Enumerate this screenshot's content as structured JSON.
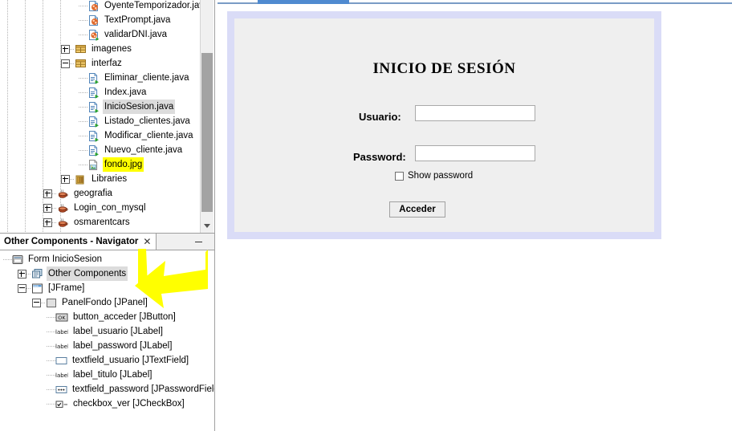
{
  "app": {
    "editor_tab_color": "#4f8ad0"
  },
  "projects_tree": {
    "nodes": [
      {
        "label": "OyenteTemporizador.java",
        "icon": "java-class-icon",
        "depth": 4,
        "expander": "none",
        "state": "normal"
      },
      {
        "label": "TextPrompt.java",
        "icon": "java-class-icon",
        "depth": 4,
        "expander": "none",
        "state": "normal"
      },
      {
        "label": "validarDNI.java",
        "icon": "java-class-main-icon",
        "depth": 4,
        "expander": "none",
        "state": "normal"
      },
      {
        "label": "imagenes",
        "icon": "package-icon",
        "depth": 3,
        "expander": "plus",
        "state": "normal"
      },
      {
        "label": "interfaz",
        "icon": "package-icon",
        "depth": 3,
        "expander": "minus",
        "state": "normal"
      },
      {
        "label": "Eliminar_cliente.java",
        "icon": "java-form-icon",
        "depth": 4,
        "expander": "none",
        "state": "normal"
      },
      {
        "label": "Index.java",
        "icon": "java-form-icon",
        "depth": 4,
        "expander": "none",
        "state": "normal"
      },
      {
        "label": "InicioSesion.java",
        "icon": "java-form-icon",
        "depth": 4,
        "expander": "none",
        "state": "selected"
      },
      {
        "label": "Listado_clientes.java",
        "icon": "java-form-icon",
        "depth": 4,
        "expander": "none",
        "state": "normal"
      },
      {
        "label": "Modificar_cliente.java",
        "icon": "java-form-icon",
        "depth": 4,
        "expander": "none",
        "state": "normal"
      },
      {
        "label": "Nuevo_cliente.java",
        "icon": "java-form-icon",
        "depth": 4,
        "expander": "none",
        "state": "normal"
      },
      {
        "label": "fondo.jpg",
        "icon": "image-file-icon",
        "depth": 4,
        "expander": "none",
        "state": "highlighted"
      },
      {
        "label": "Libraries",
        "icon": "libraries-icon",
        "depth": 3,
        "expander": "plus",
        "state": "normal"
      },
      {
        "label": "geografia",
        "icon": "java-project-icon",
        "depth": 2,
        "expander": "plus",
        "state": "normal"
      },
      {
        "label": "Login_con_mysql",
        "icon": "java-project-icon",
        "depth": 2,
        "expander": "plus",
        "state": "normal"
      },
      {
        "label": "osmarentcars",
        "icon": "java-project-icon",
        "depth": 2,
        "expander": "plus",
        "state": "normal"
      }
    ],
    "scrollbar": {
      "name": "vertical-scrollbar",
      "thumb_color": "#a3a3a3",
      "track_color": "#f0f0f0"
    }
  },
  "navigator": {
    "tab_title": "Other Components - Navigator",
    "close_glyph": "✕",
    "minimize_label": "minimize",
    "nodes": [
      {
        "label": "Form InicioSesion",
        "icon": "form-icon",
        "depth": 0,
        "expander": "none",
        "state": "normal"
      },
      {
        "label": "Other Components",
        "icon": "other-components-icon",
        "depth": 1,
        "expander": "plus",
        "state": "selected"
      },
      {
        "label": "[JFrame]",
        "icon": "jframe-icon",
        "depth": 1,
        "expander": "minus",
        "state": "normal"
      },
      {
        "label": "PanelFondo [JPanel]",
        "icon": "jpanel-icon",
        "depth": 2,
        "expander": "minus",
        "state": "normal"
      },
      {
        "label": "button_acceder [JButton]",
        "icon": "jbutton-icon",
        "depth": 3,
        "expander": "none",
        "state": "normal"
      },
      {
        "label": "label_usuario [JLabel]",
        "icon": "jlabel-icon",
        "depth": 3,
        "expander": "none",
        "state": "normal"
      },
      {
        "label": "label_password [JLabel]",
        "icon": "jlabel-icon",
        "depth": 3,
        "expander": "none",
        "state": "normal"
      },
      {
        "label": "textfield_usuario [JTextField]",
        "icon": "jtextfield-icon",
        "depth": 3,
        "expander": "none",
        "state": "normal"
      },
      {
        "label": "label_titulo [JLabel]",
        "icon": "jlabel-icon",
        "depth": 3,
        "expander": "none",
        "state": "normal"
      },
      {
        "label": "textfield_password [JPasswordField]",
        "icon": "jpasswordfield-icon",
        "depth": 3,
        "expander": "none",
        "state": "normal"
      },
      {
        "label": "checkbox_ver [JCheckBox]",
        "icon": "jcheckbox-icon",
        "depth": 3,
        "expander": "none",
        "state": "normal"
      }
    ]
  },
  "annotation": {
    "arrow_name": "yellow-arrow-annotation",
    "color": "#ffff00"
  },
  "form_designer": {
    "frame_border_color": "#dadcf7",
    "panel_background": "#efefef",
    "title": "INICIO DE SESIÓN",
    "usuario_label": "Usuario:",
    "usuario_value": "",
    "password_label": "Password:",
    "password_value": "",
    "show_password_label": "Show password",
    "show_password_checked": false,
    "acceder_button": "Acceder"
  }
}
